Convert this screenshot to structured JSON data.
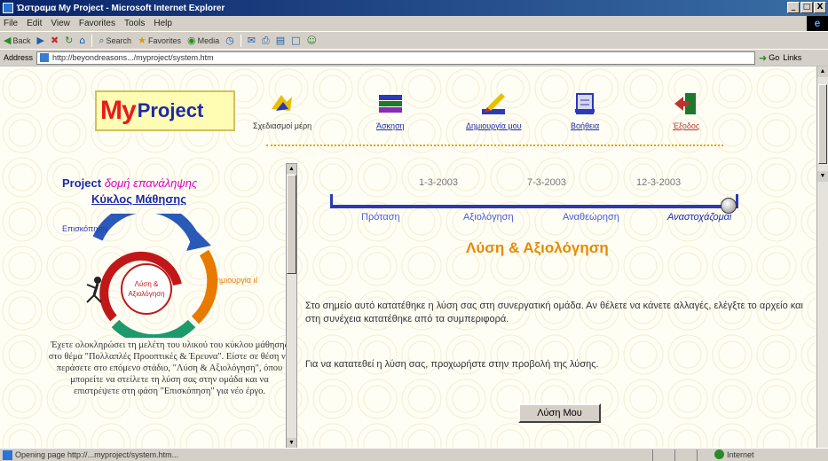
{
  "window": {
    "title": "Ώστραμα My Project - Microsoft Internet Explorer",
    "buttons": [
      "_",
      "□",
      "X"
    ]
  },
  "menu": [
    "File",
    "Edit",
    "View",
    "Favorites",
    "Tools",
    "Help"
  ],
  "toolbar": {
    "back": "Back",
    "search": "Search",
    "favorites": "Favorites",
    "media": "Media"
  },
  "address": {
    "label": "Address",
    "url": "http://beyondreasons.../myproject/system.htm",
    "go": "Go",
    "links": "Links"
  },
  "nav": [
    {
      "label": "Σχεδιασμοί μέρη",
      "icon": "mail-icon"
    },
    {
      "label": "Άσκηση",
      "icon": "books-icon"
    },
    {
      "label": "Δημιουργία μου",
      "icon": "pen-icon"
    },
    {
      "label": "Βοήθεια",
      "icon": "clipboard-icon"
    },
    {
      "label": "Έξοδος",
      "icon": "exit-icon"
    }
  ],
  "logo": {
    "my": "My",
    "project": "Project"
  },
  "left": {
    "title_prefix": "Project",
    "title_highlight": "δομή επανάληψης",
    "subtitle": "Κύκλος Μάθησης",
    "cycle_labels": {
      "top": "Επισκόπηση",
      "right": "Δημιουργία ιδεών",
      "center": "Λύση & Αξιολόγηση"
    },
    "text": "Έχετε ολοκληρώσει τη μελέτη του υλικού του κύκλου μάθησης στο θέμα \"Πολλαπλές Προοπτικές & Έρευνα\". Είστε σε θέση να περάσετε στο επόμενο στάδιο, \"Λύση & Αξιολόγηση\", όπου μπορείτε να στείλετε τη λύση σας στην ομάδα και να επιστρέψετε στη φάση \"Επισκόπηση\" για νέο έργο."
  },
  "timeline": {
    "dates": [
      "1-3-2003",
      "7-3-2003",
      "12-3-2003"
    ],
    "labels": [
      "Πρόταση",
      "Αξιολόγηση",
      "Αναθεώρηση",
      "Αναστοχάζομαι"
    ]
  },
  "right": {
    "heading": "Λύση & Αξιολόγηση",
    "paragraph": "Στο σημείο αυτό κατατέθηκε η λύση σας στη συνεργατική ομάδα. Αν θέλετε να κάνετε αλλαγές, ελέγξτε το αρχείο και στη συνέχεια κατατέθηκε από τα συμπεριφορά.",
    "paragraph2": "Για να κατατεθεί η λύση σας, προχωρήστε στην προβολή της λύσης.",
    "button": "Λύση Μου"
  },
  "status": {
    "text": "Opening page http://...myproject/system.htm...",
    "zone": "Internet"
  }
}
